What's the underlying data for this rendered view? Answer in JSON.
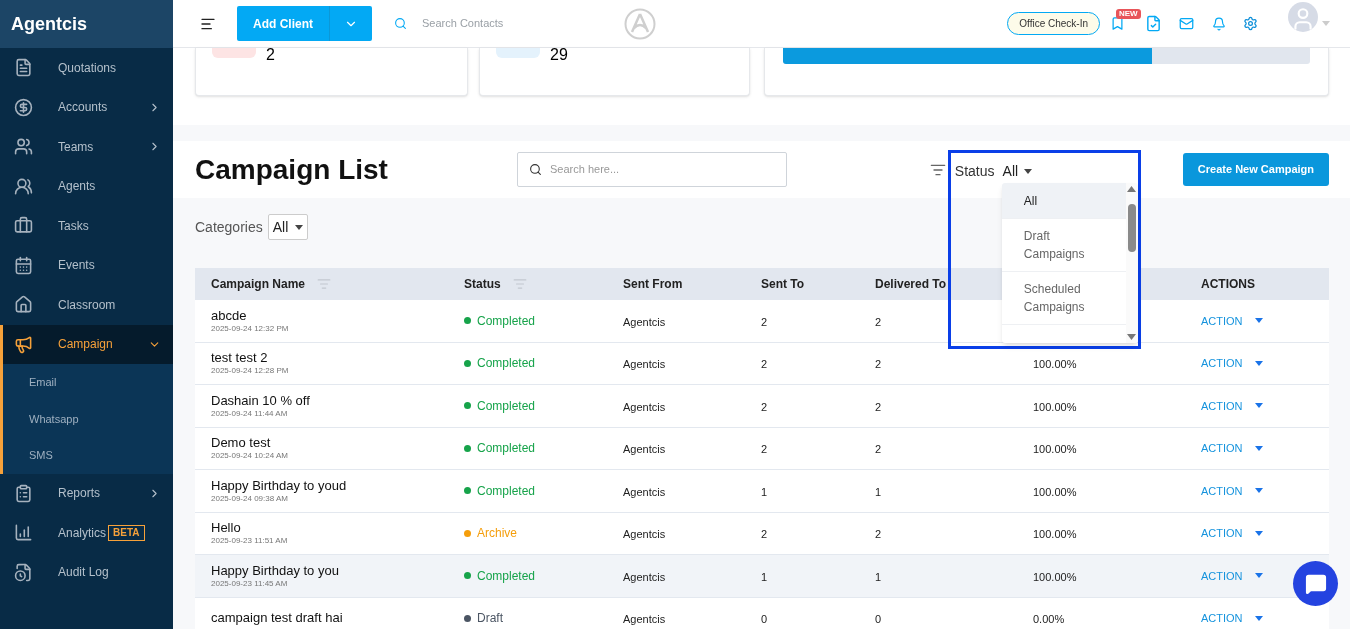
{
  "brand": "Agentcis",
  "sidebar": {
    "items": [
      {
        "label": "Quotations",
        "has_submenu": false,
        "expanded": false,
        "selected": false
      },
      {
        "label": "Accounts",
        "has_submenu": true,
        "expanded": false,
        "selected": false
      },
      {
        "label": "Teams",
        "has_submenu": true,
        "expanded": false,
        "selected": false
      },
      {
        "label": "Agents",
        "has_submenu": false,
        "expanded": false,
        "selected": false
      },
      {
        "label": "Tasks",
        "has_submenu": false,
        "expanded": false,
        "selected": false
      },
      {
        "label": "Events",
        "has_submenu": false,
        "expanded": false,
        "selected": false
      },
      {
        "label": "Classroom",
        "has_submenu": false,
        "expanded": false,
        "selected": false
      },
      {
        "label": "Campaign",
        "has_submenu": true,
        "expanded": true,
        "selected": true,
        "children": [
          {
            "label": "Email"
          },
          {
            "label": "Whatsapp"
          },
          {
            "label": "SMS"
          }
        ]
      },
      {
        "label": "Reports",
        "has_submenu": true,
        "expanded": false,
        "selected": false
      },
      {
        "label": "Analytics",
        "has_submenu": false,
        "expanded": false,
        "selected": false,
        "badge": "BETA"
      },
      {
        "label": "Audit Log",
        "has_submenu": false,
        "expanded": false,
        "selected": false
      }
    ]
  },
  "header": {
    "add_client": "Add Client",
    "search": {
      "placeholder": "Search Contacts"
    },
    "check_in": "Office Check-In",
    "new_badge": "NEW"
  },
  "stats": [
    {
      "value": "2",
      "color": "#fde4e4"
    },
    {
      "value": "29",
      "color": "#e4f2fc"
    }
  ],
  "progress": {
    "level": 0.7
  },
  "campaign_list": {
    "title": "Campaign List",
    "search": {
      "placeholder": "Search here..."
    },
    "status_filter": {
      "label": "Status",
      "value": "All",
      "expanded": true,
      "options": [
        {
          "label": "All",
          "selected": true
        },
        {
          "label": "Draft Campaigns",
          "selected": false
        },
        {
          "label": "Scheduled Campaigns",
          "selected": false
        }
      ]
    },
    "create_button": "Create New Campaign",
    "categories": {
      "label": "Categories",
      "value": "All"
    }
  },
  "table": {
    "columns": [
      {
        "label": "Campaign Name",
        "sortable": true
      },
      {
        "label": "Status",
        "sortable": true
      },
      {
        "label": "Sent From",
        "sortable": false
      },
      {
        "label": "Sent To",
        "sortable": false
      },
      {
        "label": "Delivered To",
        "sortable": false
      },
      {
        "label": "ACTIONS",
        "sortable": false
      }
    ],
    "rows": [
      {
        "name": "abcde",
        "date": "2025-09-24 12:32 PM",
        "status": {
          "label": "Completed",
          "color": "#16a34a"
        },
        "sent_from": "Agentcis",
        "sent_to": "2",
        "delivered_to": "2",
        "action": "ACTION",
        "selected": false
      },
      {
        "name": "test test 2",
        "date": "2025-09-24 12:28 PM",
        "status": {
          "label": "Completed",
          "color": "#16a34a"
        },
        "sent_from": "Agentcis",
        "sent_to": "2",
        "delivered_to": "2",
        "rate": "100.00%",
        "action": "ACTION",
        "selected": false
      },
      {
        "name": "Dashain 10 % off",
        "date": "2025-09-24 11:44 AM",
        "status": {
          "label": "Completed",
          "color": "#16a34a"
        },
        "sent_from": "Agentcis",
        "sent_to": "2",
        "delivered_to": "2",
        "rate": "100.00%",
        "action": "ACTION",
        "selected": false
      },
      {
        "name": "Demo test",
        "date": "2025-09-24 10:24 AM",
        "status": {
          "label": "Completed",
          "color": "#16a34a"
        },
        "sent_from": "Agentcis",
        "sent_to": "2",
        "delivered_to": "2",
        "rate": "100.00%",
        "action": "ACTION",
        "selected": false
      },
      {
        "name": "Happy Birthday to youd",
        "date": "2025-09-24 09:38 AM",
        "status": {
          "label": "Completed",
          "color": "#16a34a"
        },
        "sent_from": "Agentcis",
        "sent_to": "1",
        "delivered_to": "1",
        "rate": "100.00%",
        "action": "ACTION",
        "selected": false
      },
      {
        "name": "Hello",
        "date": "2025-09-23 11:51 AM",
        "status": {
          "label": "Archive",
          "color": "#f59e0b"
        },
        "sent_from": "Agentcis",
        "sent_to": "2",
        "delivered_to": "2",
        "rate": "100.00%",
        "action": "ACTION",
        "selected": false
      },
      {
        "name": "Happy Birthday to you",
        "date": "2025-09-23 11:45 AM",
        "status": {
          "label": "Completed",
          "color": "#16a34a"
        },
        "sent_from": "Agentcis",
        "sent_to": "1",
        "delivered_to": "1",
        "rate": "100.00%",
        "action": "ACTION",
        "selected": true
      },
      {
        "name": "campaign test draft hai",
        "status": {
          "label": "Draft",
          "color": "#4b5563"
        },
        "sent_from": "Agentcis",
        "sent_to": "0",
        "delivered_to": "0",
        "rate": "0.00%",
        "action": "ACTION",
        "selected": false
      }
    ]
  }
}
